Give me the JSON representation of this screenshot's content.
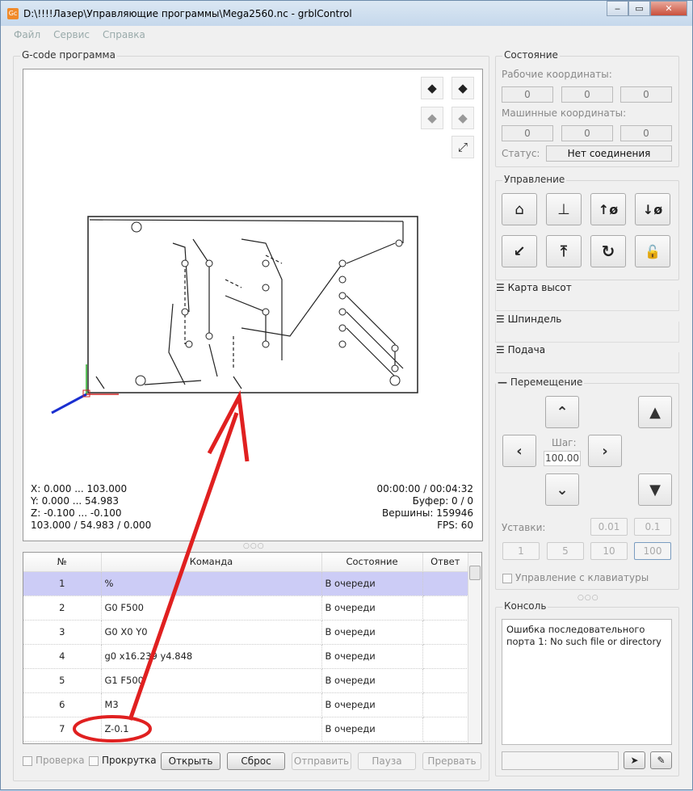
{
  "window": {
    "title": "D:\\!!!!Лазер\\Управляющие программы\\Mega2560.nc - grblControl",
    "icon": "Gc"
  },
  "menu": [
    "Файл",
    "Сервис",
    "Справка"
  ],
  "gcode": {
    "title": "G-code программа",
    "info_left": [
      "X: 0.000 ... 103.000",
      "Y: 0.000 ... 54.983",
      "Z: -0.100 ... -0.100",
      "103.000 / 54.983 / 0.000"
    ],
    "info_right": [
      "00:00:00 / 00:04:32",
      "Буфер: 0 / 0",
      "Вершины: 159946",
      "FPS: 60"
    ]
  },
  "table": {
    "headers": [
      "№",
      "Команда",
      "Состояние",
      "Ответ"
    ],
    "rows": [
      [
        "1",
        "%",
        "В очереди",
        ""
      ],
      [
        "2",
        "G0 F500",
        "В очереди",
        ""
      ],
      [
        "3",
        "G0 X0 Y0",
        "В очереди",
        ""
      ],
      [
        "4",
        "g0 x16.239 y4.848",
        "В очереди",
        ""
      ],
      [
        "5",
        "G1 F500",
        "В очереди",
        ""
      ],
      [
        "6",
        "M3",
        "В очереди",
        ""
      ],
      [
        "7",
        "Z-0.1",
        "В очереди",
        ""
      ]
    ]
  },
  "bottom": {
    "check": "Проверка",
    "scroll": "Прокрутка",
    "open": "Открыть",
    "reset": "Сброс",
    "send": "Отправить",
    "pause": "Пауза",
    "abort": "Прервать"
  },
  "state": {
    "title": "Состояние",
    "work_label": "Рабочие координаты:",
    "work": [
      "0",
      "0",
      "0"
    ],
    "machine_label": "Машинные координаты:",
    "machine": [
      "0",
      "0",
      "0"
    ],
    "status_label": "Статус:",
    "status": "Нет соединения"
  },
  "control": {
    "title": "Управление"
  },
  "collapsed": [
    "Карта высот",
    "Шпиндель",
    "Подача"
  ],
  "jog": {
    "title": "Перемещение",
    "step_label": "Шаг:",
    "step": "100.00",
    "presets_label": "Уставки:",
    "presets": [
      "0.01",
      "0.1",
      "1",
      "5",
      "10",
      "100"
    ],
    "keyboard": "Управление с клавиатуры"
  },
  "console": {
    "title": "Консоль",
    "text": "Ошибка последовательного порта 1: No such file or directory"
  },
  "colors": {
    "selected_row": "#ccccf6",
    "annotation": "#e02020"
  }
}
